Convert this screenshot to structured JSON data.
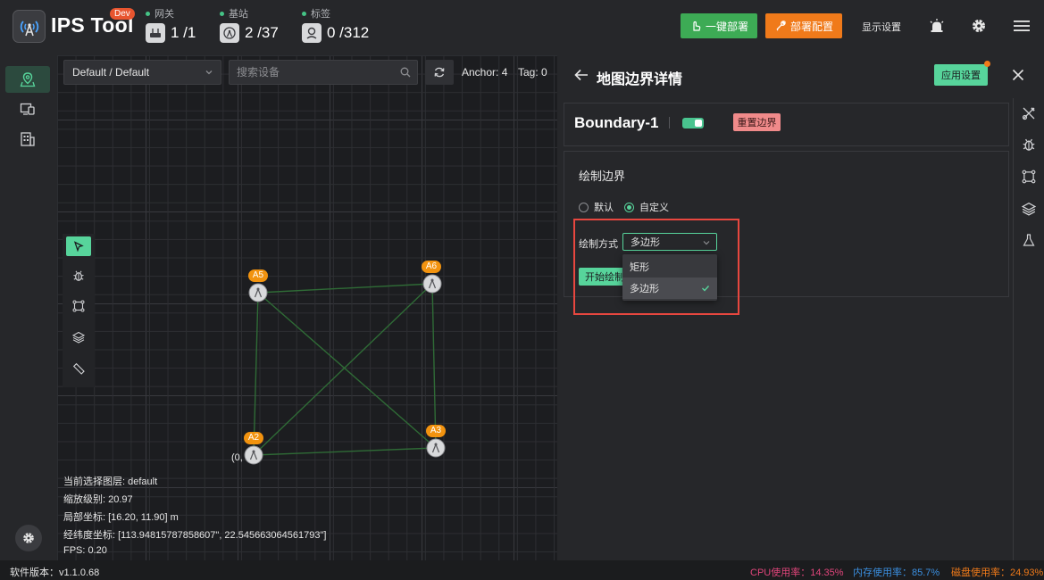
{
  "app": {
    "title": "IPS Tool",
    "badge": "Dev"
  },
  "stats": [
    {
      "label": "网关",
      "value": "1 /1",
      "icon": "gateway-icon"
    },
    {
      "label": "基站",
      "value": "2 /37",
      "icon": "anchor-icon"
    },
    {
      "label": "标签",
      "value": "0 /312",
      "icon": "tag-icon"
    }
  ],
  "toolbar": {
    "deploy_label": "一键部署",
    "config_label": "部署配置",
    "display_label": "显示设置"
  },
  "map": {
    "layer_select": "Default / Default",
    "search_placeholder": "搜索设备",
    "anchor_count": "Anchor: 4",
    "tag_count": "Tag: 0",
    "origin_label": "(0,",
    "anchors": [
      {
        "id": "A5"
      },
      {
        "id": "A6"
      },
      {
        "id": "A2"
      },
      {
        "id": "A3"
      }
    ],
    "info": {
      "layer": "当前选择图层:  default",
      "zoom": "缩放级别:  20.97",
      "local": "局部坐标:  [16.20,  11.90] m",
      "lonlat": "经纬度坐标:  [113.94815787858607\",  22.545663064561793\"]",
      "fps": "FPS:  0.20"
    }
  },
  "panel": {
    "title": "地图边界详情",
    "apply_label": "应用设置",
    "boundary_name": "Boundary-1",
    "boundary_enabled": true,
    "reset_label": "重置边界",
    "section_title": "绘制边界",
    "radio_options": [
      {
        "label": "默认",
        "selected": false
      },
      {
        "label": "自定义",
        "selected": true
      }
    ],
    "draw_method_label": "绘制方式",
    "draw_method_value": "多边形",
    "start_label": "开始绘制",
    "dropdown_options": [
      {
        "label": "矩形",
        "selected": false
      },
      {
        "label": "多边形",
        "selected": true
      }
    ]
  },
  "footer": {
    "version": "软件版本：v1.1.0.68",
    "cpu": "CPU使用率：14.35%",
    "memory": "内存使用率：85.7%",
    "disk": "磁盘使用率：24.93%"
  },
  "colors": {
    "accent": "#57d49b",
    "deploy": "#3dab55",
    "config": "#f07a1a",
    "anchor_label": "#f2930f",
    "danger": "#e8473f",
    "cpu": "#e0457b",
    "memory": "#3b8fe0",
    "disk": "#f07a1a"
  }
}
